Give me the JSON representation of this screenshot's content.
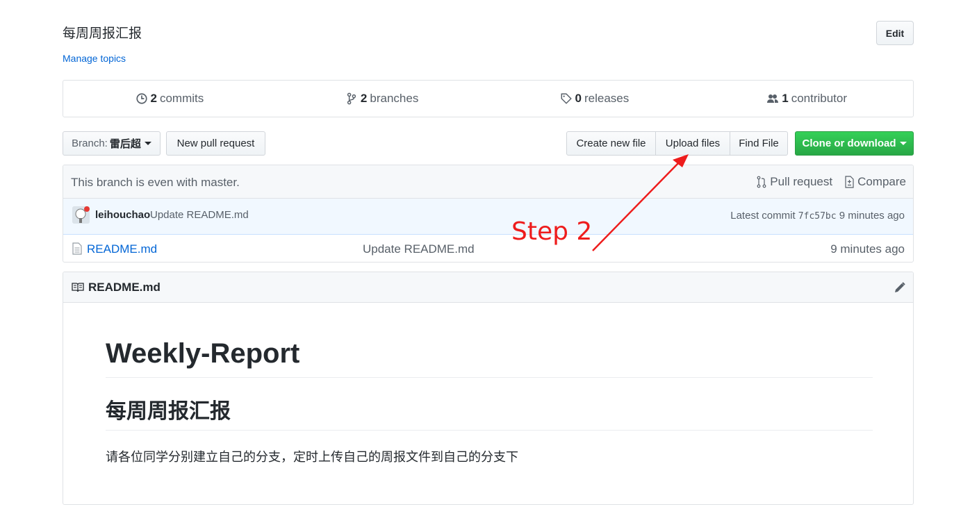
{
  "repo": {
    "description": "每周周报汇报",
    "manage_topics": "Manage topics",
    "edit_label": "Edit"
  },
  "numbers": {
    "commits_count": "2",
    "commits_label": "commits",
    "branches_count": "2",
    "branches_label": "branches",
    "releases_count": "0",
    "releases_label": "releases",
    "contributors_count": "1",
    "contributors_label": "contributor"
  },
  "toolbar": {
    "branch_prefix": "Branch:",
    "branch_name": "雷后超",
    "new_pull_request": "New pull request",
    "create_new_file": "Create new file",
    "upload_files": "Upload files",
    "find_file": "Find File",
    "clone_or_download": "Clone or download"
  },
  "branch_info": {
    "message": "This branch is even with master.",
    "pull_request": "Pull request",
    "compare": "Compare"
  },
  "commit": {
    "author": "leihouchao",
    "message": "Update README.md",
    "latest_label": "Latest commit",
    "sha": "7fc57bc",
    "age": "9 minutes ago"
  },
  "files": [
    {
      "name": "README.md",
      "message": "Update README.md",
      "age": "9 minutes ago"
    }
  ],
  "readme": {
    "header": "README.md",
    "h1": "Weekly-Report",
    "h2": "每周周报汇报",
    "paragraph": "请各位同学分别建立自己的分支，定时上传自己的周报文件到自己的分支下"
  },
  "annotation": {
    "step_label": "Step 2",
    "color": "#ee1c1c"
  },
  "colors": {
    "link": "#0366d6",
    "clone_green": "#28a745"
  }
}
